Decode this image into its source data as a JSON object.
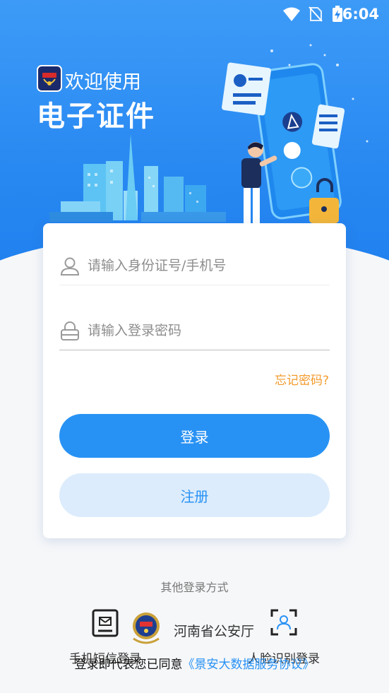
{
  "status_bar": {
    "time": "6:04",
    "icons": [
      "wifi-icon",
      "no-sim-icon",
      "battery-charging-icon"
    ]
  },
  "brand": {
    "welcome": "欢迎使用",
    "title": "电子证件",
    "logo_icon": "police-badge-icon"
  },
  "login_form": {
    "id_placeholder": "请输入身份证号/手机号",
    "password_placeholder": "请输入登录密码",
    "forgot_label": "忘记密码?",
    "login_label": "登录",
    "register_label": "注册"
  },
  "other_login": {
    "title": "其他登录方式",
    "sms_label": "手机短信登录",
    "provider_label": "河南省公安厅",
    "face_label": "人脸识别登录"
  },
  "agreement": {
    "prefix": "登录即代表您已同意",
    "link": "《景安大数据服务协议》"
  },
  "colors": {
    "primary": "#2892f4",
    "hero": "#2a8af2",
    "warning": "#f29b2d",
    "register_bg": "#dcecfc"
  }
}
